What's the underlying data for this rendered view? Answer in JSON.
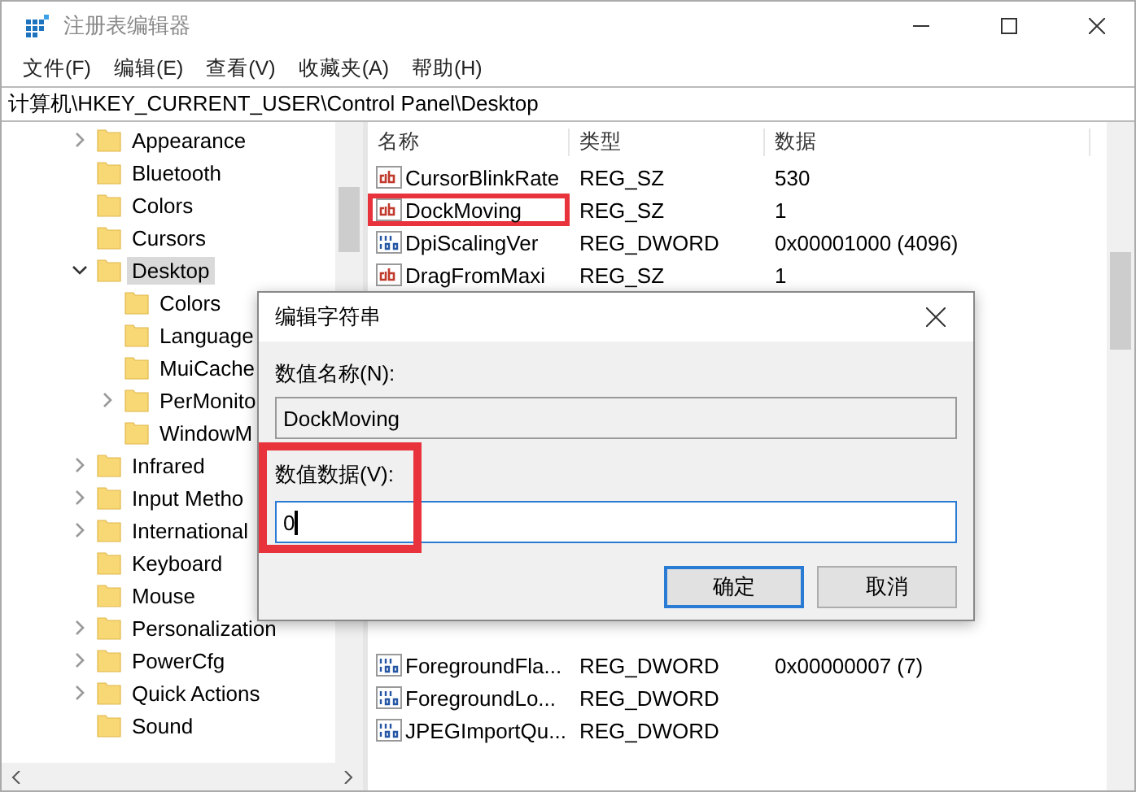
{
  "window": {
    "title": "注册表编辑器"
  },
  "menu": [
    {
      "label": "文件(F)"
    },
    {
      "label": "编辑(E)"
    },
    {
      "label": "查看(V)"
    },
    {
      "label": "收藏夹(A)"
    },
    {
      "label": "帮助(H)"
    }
  ],
  "address": "计算机\\HKEY_CURRENT_USER\\Control Panel\\Desktop",
  "tree": [
    {
      "label": "Appearance",
      "expanded": false,
      "selected": false
    },
    {
      "label": "Bluetooth",
      "selected": false
    },
    {
      "label": "Colors",
      "selected": false
    },
    {
      "label": "Cursors",
      "selected": false
    },
    {
      "label": "Desktop",
      "expanded": true,
      "selected": true,
      "children": [
        {
          "label": "Colors",
          "selected": false
        },
        {
          "label": "Language",
          "selected": false
        },
        {
          "label": "MuiCache",
          "selected": false
        },
        {
          "label": "PerMonito",
          "expanded": false,
          "selected": false
        },
        {
          "label": "WindowM",
          "selected": false
        }
      ]
    },
    {
      "label": "Infrared",
      "expanded": false,
      "selected": false
    },
    {
      "label": "Input Metho",
      "expanded": false,
      "selected": false
    },
    {
      "label": "International",
      "expanded": false,
      "selected": false
    },
    {
      "label": "Keyboard",
      "selected": false
    },
    {
      "label": "Mouse",
      "selected": false
    },
    {
      "label": "Personalization",
      "expanded": false,
      "selected": false
    },
    {
      "label": "PowerCfg",
      "expanded": false,
      "selected": false
    },
    {
      "label": "Quick Actions",
      "expanded": false,
      "selected": false
    },
    {
      "label": "Sound",
      "selected": false
    }
  ],
  "list": {
    "columns": [
      "名称",
      "类型",
      "数据"
    ],
    "rows_above_dialog": [
      {
        "kind": "string",
        "name": "CursorBlinkRate",
        "type": "REG_SZ",
        "data": "530",
        "highlighted": false
      },
      {
        "kind": "string",
        "name": "DockMoving",
        "type": "REG_SZ",
        "data": "1",
        "highlighted": true
      },
      {
        "kind": "binary",
        "name": "DpiScalingVer",
        "type": "REG_DWORD",
        "data": "0x00001000 (4096)",
        "highlighted": false
      },
      {
        "kind": "string",
        "name": "DragFromMaxi",
        "type": "REG_SZ",
        "data": "1",
        "highlighted": false
      }
    ],
    "rows_below_dialog": [
      {
        "kind": "binary",
        "name": "ForegroundFla...",
        "type": "REG_DWORD",
        "data": "0x00000007 (7)",
        "highlighted": false
      },
      {
        "kind": "binary",
        "name": "ForegroundLo...",
        "type": "REG_DWORD",
        "highlighted": false
      },
      {
        "kind": "binary",
        "name": "JPEGImportQu...",
        "type": "REG_DWORD",
        "highlighted": false
      }
    ]
  },
  "dialog": {
    "title": "编辑字符串",
    "name_label": "数值名称(N):",
    "name_value": "DockMoving",
    "data_label": "数值数据(V):",
    "data_value": "0",
    "data_highlighted": true,
    "buttons": [
      {
        "label": "确定",
        "default": true
      },
      {
        "label": "取消",
        "default": false
      }
    ]
  }
}
